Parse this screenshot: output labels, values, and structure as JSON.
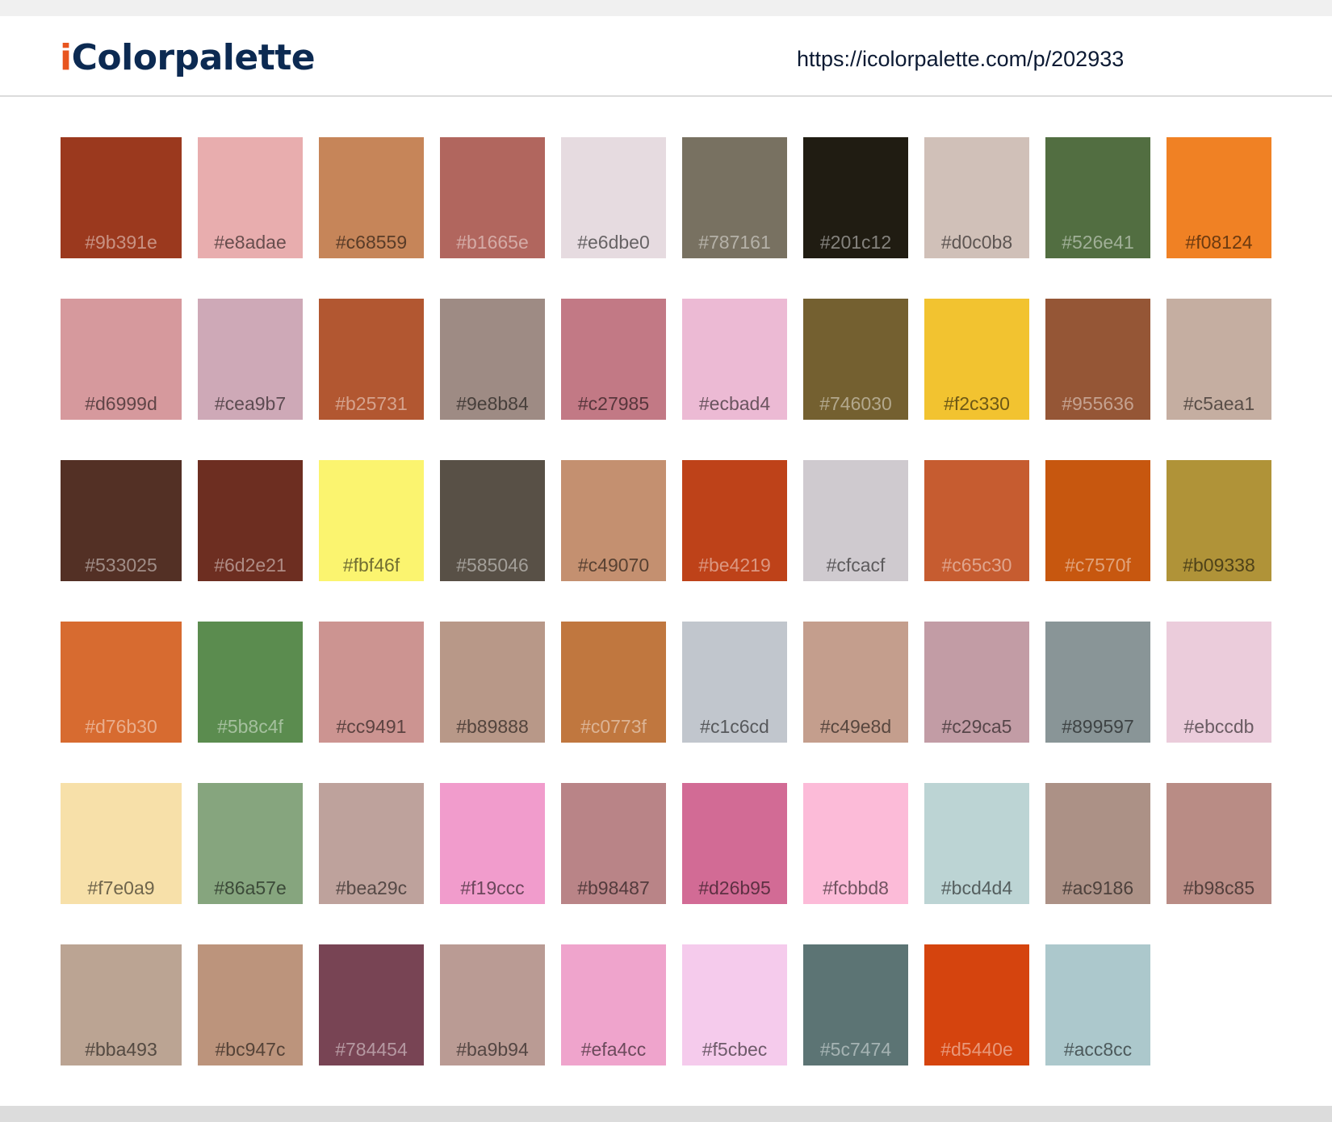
{
  "header": {
    "logo_i": "i",
    "logo_rest": "Colorpalette",
    "url": "https://icolorpalette.com/p/202933"
  },
  "colors": {
    "logo_accent": "#e8551f",
    "logo_main": "#0c2a52",
    "top_strip": "#f0f0f0",
    "bottom_strip": "#dcdcdc"
  },
  "swatches": [
    "#9b391e",
    "#e8adae",
    "#c68559",
    "#b1665e",
    "#e6dbe0",
    "#787161",
    "#201c12",
    "#d0c0b8",
    "#526e41",
    "#f08124",
    "#d6999d",
    "#cea9b7",
    "#b25731",
    "#9e8b84",
    "#c27985",
    "#ecbad4",
    "#746030",
    "#f2c330",
    "#955636",
    "#c5aea1",
    "#533025",
    "#6d2e21",
    "#fbf46f",
    "#585046",
    "#c49070",
    "#be4219",
    "#cfcacf",
    "#c65c30",
    "#c7570f",
    "#b09338",
    "#d76b30",
    "#5b8c4f",
    "#cc9491",
    "#b89888",
    "#c0773f",
    "#c1c6cd",
    "#c49e8d",
    "#c29ca5",
    "#899597",
    "#ebccdb",
    "#f7e0a9",
    "#86a57e",
    "#bea29c",
    "#f19ccc",
    "#b98487",
    "#d26b95",
    "#fcbbd8",
    "#bcd4d4",
    "#ac9186",
    "#b98c85",
    "#bba493",
    "#bc947c",
    "#784454",
    "#ba9b94",
    "#efa4cc",
    "#f5cbec",
    "#5c7474",
    "#d5440e",
    "#acc8cc"
  ]
}
